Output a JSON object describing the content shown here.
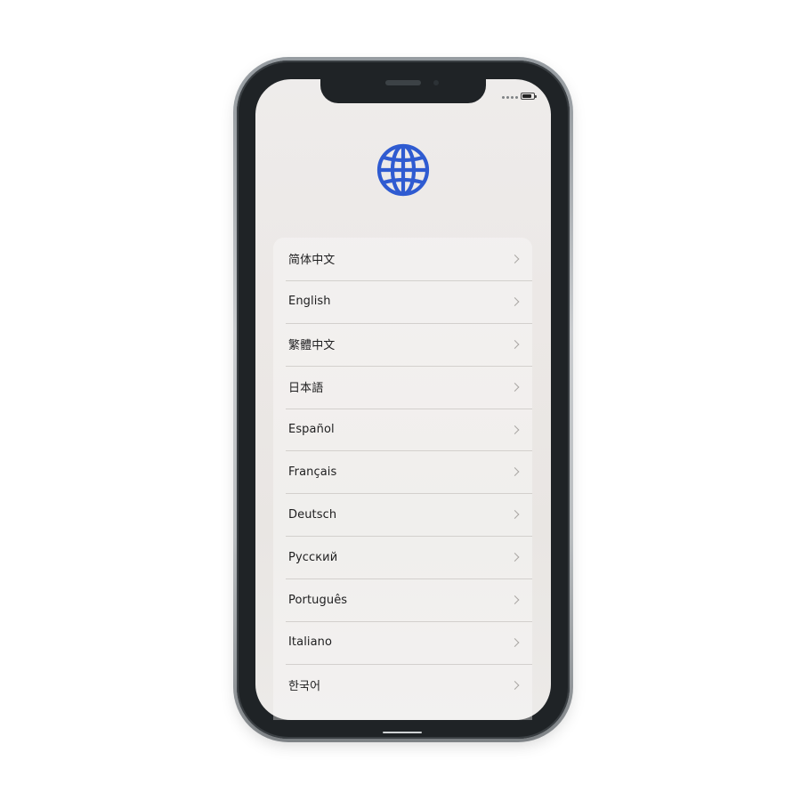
{
  "screen": {
    "icon": "globe-icon",
    "accent_color": "#2f5bd1"
  },
  "languages": [
    {
      "label": "简体中文"
    },
    {
      "label": "English"
    },
    {
      "label": "繁體中文"
    },
    {
      "label": "日本語"
    },
    {
      "label": "Español"
    },
    {
      "label": "Français"
    },
    {
      "label": "Deutsch"
    },
    {
      "label": "Русский"
    },
    {
      "label": "Português"
    },
    {
      "label": "Italiano"
    },
    {
      "label": "한국어"
    }
  ]
}
